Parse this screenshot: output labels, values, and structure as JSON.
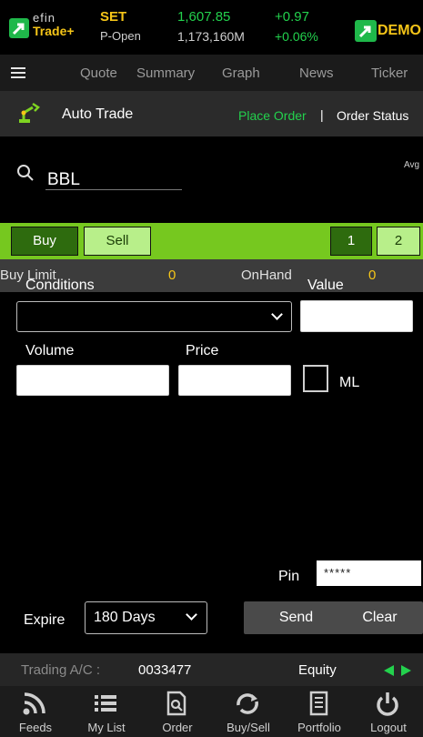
{
  "header": {
    "logo": {
      "efin": "efin",
      "trade": "Trade+"
    },
    "market": "SET",
    "session": "P-Open",
    "index_value": "1,607.85",
    "volume": "1,173,160M",
    "change": "+0.97",
    "change_pct": "+0.06%",
    "demo_label": "DEMO"
  },
  "menu": {
    "items": [
      "Quote",
      "Summary",
      "Graph",
      "News",
      "Ticker"
    ]
  },
  "subbar": {
    "title": "Auto Trade",
    "place_order": "Place Order",
    "separator": "|",
    "order_status": "Order Status"
  },
  "search": {
    "symbol": "BBL",
    "avg_label": "Avg"
  },
  "side_tabs": {
    "buy": "Buy",
    "sell": "Sell",
    "page1": "1",
    "page2": "2"
  },
  "limits": {
    "buy_limit_label": "Buy Limit",
    "buy_limit_value": "0",
    "onhand_label": "OnHand",
    "onhand_value": "0"
  },
  "form": {
    "conditions_label": "Conditions",
    "conditions_value": "",
    "value_label": "Value",
    "value_value": "",
    "volume_label": "Volume",
    "volume_value": "",
    "price_label": "Price",
    "price_value": "",
    "ml_label": "ML",
    "pin_label": "Pin",
    "pin_value": "*****",
    "expire_label": "Expire",
    "expire_value": "180 Days",
    "send_label": "Send",
    "clear_label": "Clear"
  },
  "account": {
    "label": "Trading A/C :",
    "number": "0033477",
    "type": "Equity"
  },
  "bottom_nav": [
    "Feeds",
    "My List",
    "Order",
    "Buy/Sell",
    "Portfolio",
    "Logout"
  ],
  "colors": {
    "accent_green": "#23d14d",
    "bar_green": "#76c81f",
    "brand_yellow": "#f5c518"
  }
}
